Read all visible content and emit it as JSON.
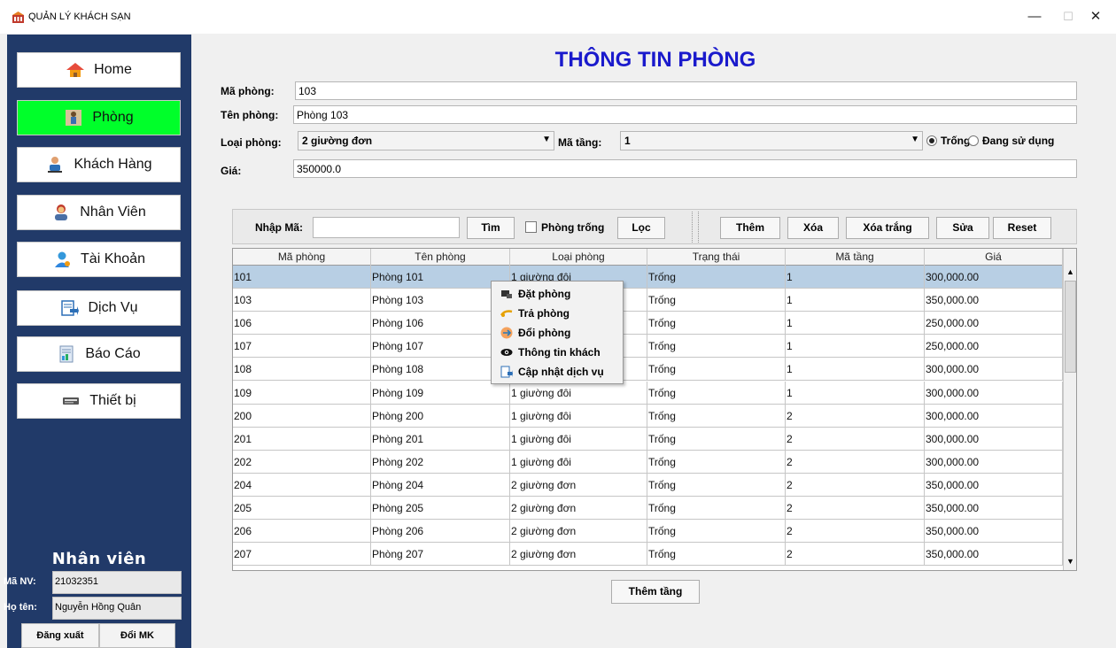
{
  "window": {
    "title": "QUẢN LÝ KHÁCH SẠN",
    "controls": {
      "minimize": "—",
      "maximize": "☐",
      "close": "✕"
    }
  },
  "sidebar": {
    "items": [
      {
        "label": "Home",
        "icon": "home-icon",
        "active": false
      },
      {
        "label": "Phòng",
        "icon": "room-icon",
        "active": true
      },
      {
        "label": "Khách Hàng",
        "icon": "customer-icon",
        "active": false
      },
      {
        "label": "Nhân Viên",
        "icon": "employee-icon",
        "active": false
      },
      {
        "label": "Tài Khoản",
        "icon": "account-icon",
        "active": false
      },
      {
        "label": "Dịch Vụ",
        "icon": "service-icon",
        "active": false
      },
      {
        "label": "Báo Cáo",
        "icon": "report-icon",
        "active": false
      },
      {
        "label": "Thiết bị",
        "icon": "device-icon",
        "active": false
      }
    ],
    "staff": {
      "title": "Nhân viên",
      "id_label": "Mã NV:",
      "id_value": "21032351",
      "name_label": "Họ tên:",
      "name_value": "Nguyễn Hồng Quân",
      "logout_label": "Đăng xuất",
      "change_pw_label": "Đổi MK"
    },
    "colors": {
      "background": "#213a69",
      "active": "#00ff2a"
    }
  },
  "form": {
    "title": "THÔNG TIN PHÒNG",
    "room_id_label": "Mã phòng:",
    "room_id_value": "103",
    "room_name_label": "Tên phòng:",
    "room_name_value": "Phòng 103",
    "room_type_label": "Loại phòng:",
    "room_type_value": "2 giường đơn",
    "floor_label": "Mã tầng:",
    "floor_value": "1",
    "status_options": [
      {
        "label": "Trống",
        "selected": true
      },
      {
        "label": "Đang sử dụng",
        "selected": false
      }
    ],
    "price_label": "Giá:",
    "price_value": "350000.0"
  },
  "toolbar": {
    "search_label": "Nhập Mã:",
    "search_value": "",
    "search_button": "Tìm",
    "empty_room_checkbox": "Phòng trống",
    "filter_button": "Lọc",
    "add_button": "Thêm",
    "delete_button": "Xóa",
    "clear_button": "Xóa trắng",
    "edit_button": "Sửa",
    "reset_button": "Reset"
  },
  "table": {
    "columns": [
      "Mã phòng",
      "Tên phòng",
      "Loại phòng",
      "Trạng thái",
      "Mã tầng",
      "Giá"
    ],
    "rows": [
      [
        "101",
        "Phòng 101",
        "1 giường đôi",
        "Trống",
        "1",
        "300,000.00"
      ],
      [
        "103",
        "Phòng 103",
        "2 giường đơn",
        "Trống",
        "1",
        "350,000.00"
      ],
      [
        "106",
        "Phòng 106",
        "2 giường đơn",
        "Trống",
        "1",
        "250,000.00"
      ],
      [
        "107",
        "Phòng 107",
        "2 giường đơn",
        "Trống",
        "1",
        "250,000.00"
      ],
      [
        "108",
        "Phòng 108",
        "1 giường đôi",
        "Trống",
        "1",
        "300,000.00"
      ],
      [
        "109",
        "Phòng 109",
        "1 giường đôi",
        "Trống",
        "1",
        "300,000.00"
      ],
      [
        "200",
        "Phòng 200",
        "1 giường đôi",
        "Trống",
        "2",
        "300,000.00"
      ],
      [
        "201",
        "Phòng 201",
        "1 giường đôi",
        "Trống",
        "2",
        "300,000.00"
      ],
      [
        "202",
        "Phòng 202",
        "1 giường đôi",
        "Trống",
        "2",
        "300,000.00"
      ],
      [
        "204",
        "Phòng 204",
        "2 giường đơn",
        "Trống",
        "2",
        "350,000.00"
      ],
      [
        "205",
        "Phòng 205",
        "2 giường đơn",
        "Trống",
        "2",
        "350,000.00"
      ],
      [
        "206",
        "Phòng 206",
        "2 giường đơn",
        "Trống",
        "2",
        "350,000.00"
      ],
      [
        "207",
        "Phòng 207",
        "2 giường đơn",
        "Trống",
        "2",
        "350,000.00"
      ]
    ],
    "selected_row": 0
  },
  "context_menu": {
    "items": [
      {
        "label": "Đặt phòng",
        "icon": "book-room-icon"
      },
      {
        "label": "Trả phòng",
        "icon": "checkout-icon"
      },
      {
        "label": "Đổi phòng",
        "icon": "change-room-icon"
      },
      {
        "label": "Thông tin khách",
        "icon": "eye-icon"
      },
      {
        "label": "Cập nhật dịch vụ",
        "icon": "update-service-icon"
      }
    ]
  },
  "footer": {
    "add_floor_button": "Thêm tầng"
  }
}
